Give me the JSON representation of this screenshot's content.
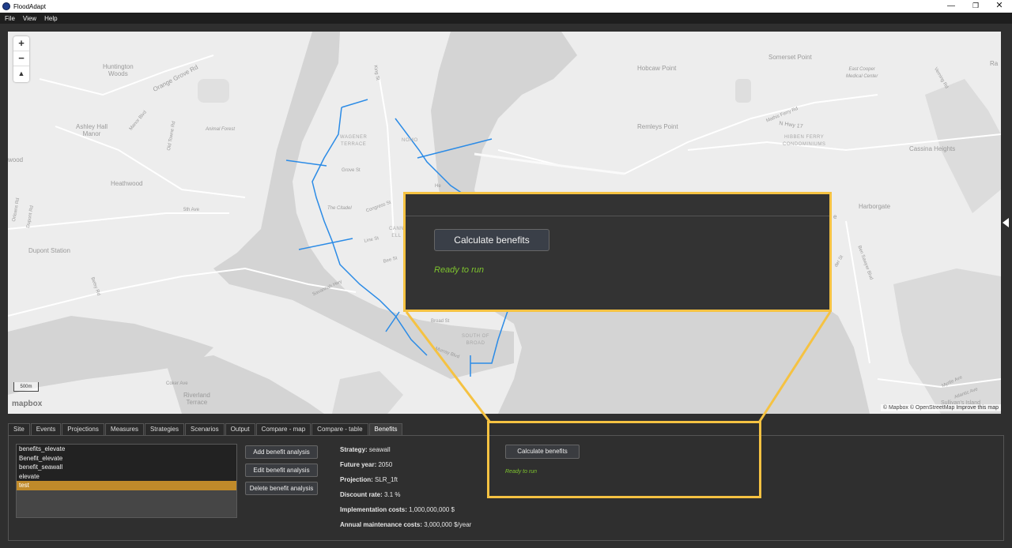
{
  "window": {
    "title": "FloodAdapt",
    "minimize": "—",
    "restore": "❐",
    "close": "✕"
  },
  "menu": [
    "File",
    "View",
    "Help"
  ],
  "map": {
    "zoom_in": "+",
    "zoom_out": "−",
    "compass": "▲",
    "scale": "500m",
    "logo": "mapbox",
    "attribution_mapbox": "© Mapbox",
    "attribution_osm": "© OpenStreetMap",
    "attribution_improve": "Improve this map",
    "labels": {
      "huntington_woods": "Huntington\nWoods",
      "orange_grove_rd": "Orange Grove Rd",
      "ashley_hall_manor": "Ashley Hall\nManor",
      "manor_blvd": "Manor Blvd",
      "old_towne_rd": "Old Towne Rd",
      "animal_forest": "Animal Forest",
      "wood": "wood",
      "heathwood": "Heathwood",
      "orleans_rd": "Orleans Rd",
      "dupont_rd": "Dupont Rd",
      "fifth_ave": "5th Ave",
      "dupont_station": "Dupont Station",
      "betsy_rd": "Betsy Rd",
      "coker_ave": "Coker Ave",
      "riverland_terrace": "Riverland\nTerrace",
      "king_st": "King St",
      "wagener_terrace": "WAGENER\nTERRACE",
      "nomo": "NOMO",
      "grove_st": "Grove St",
      "the_citadel": "The Citadel",
      "congress_st": "Congress St",
      "line_st": "Line St",
      "cannon_elliot": "CANN\nELL",
      "bee_st": "Bee St",
      "savannah_hwy": "Savannah Hwy",
      "broad_st": "Broad St",
      "south_of_broad": "SOUTH OF\nBROAD",
      "murray_blvd": "Murray Blvd",
      "hobcaw_point": "Hobcaw Point",
      "somerset_point": "Somerset Point",
      "east_cooper": "East Cooper\nMedical Center",
      "mathis_ferry_rd": "Mathis Ferry Rd",
      "n_hwy_17": "N Hwy 17",
      "remleys_point": "Remleys Point",
      "hibben_ferry": "HIBBEN FERRY\nCONDOMINIUMS",
      "cassina_heights": "Cassina Heights",
      "harborgate": "Harborgate",
      "ben_sawyer_blvd": "Ben Sawyer Blvd",
      "myrtle_ave": "Myrtle Ave",
      "atlantic_ave": "Atlantic Ave",
      "sullivans_island": "Sullivan's Island",
      "verning_rd": "Verning Rd",
      "ra": "Ra",
      "e": "e",
      "der_st": "der St",
      "he": "He"
    }
  },
  "callout": {
    "button": "Calculate benefits",
    "status": "Ready to run"
  },
  "tabs": [
    "Site",
    "Events",
    "Projections",
    "Measures",
    "Strategies",
    "Scenarios",
    "Output",
    "Compare - map",
    "Compare - table",
    "Benefits"
  ],
  "active_tab": "Benefits",
  "benefits": {
    "list": [
      "benefits_elevate",
      "Benefit_elevate",
      "benefit_seawall",
      "elevate",
      "test"
    ],
    "selected": "test",
    "buttons": {
      "add": "Add benefit analysis",
      "edit": "Edit benefit analysis",
      "delete": "Delete benefit analysis"
    },
    "details": {
      "strategy_label": "Strategy:",
      "strategy_value": "seawall",
      "future_year_label": "Future year:",
      "future_year_value": "2050",
      "projection_label": "Projection:",
      "projection_value": "SLR_1ft",
      "discount_rate_label": "Discount rate:",
      "discount_rate_value": "3.1 %",
      "impl_costs_label": "Implementation costs:",
      "impl_costs_value": "1,000,000,000 $",
      "maint_costs_label": "Annual maintenance costs:",
      "maint_costs_value": "3,000,000 $/year"
    },
    "calculate_button": "Calculate benefits",
    "status": "Ready to run"
  },
  "colors": {
    "accent_highlight": "#f5c242",
    "status_green": "#7ec42e",
    "selected_row": "#c08a2a",
    "water": "#d3d3d3",
    "land": "#ededed",
    "measure_lines": "#2b8be6"
  }
}
